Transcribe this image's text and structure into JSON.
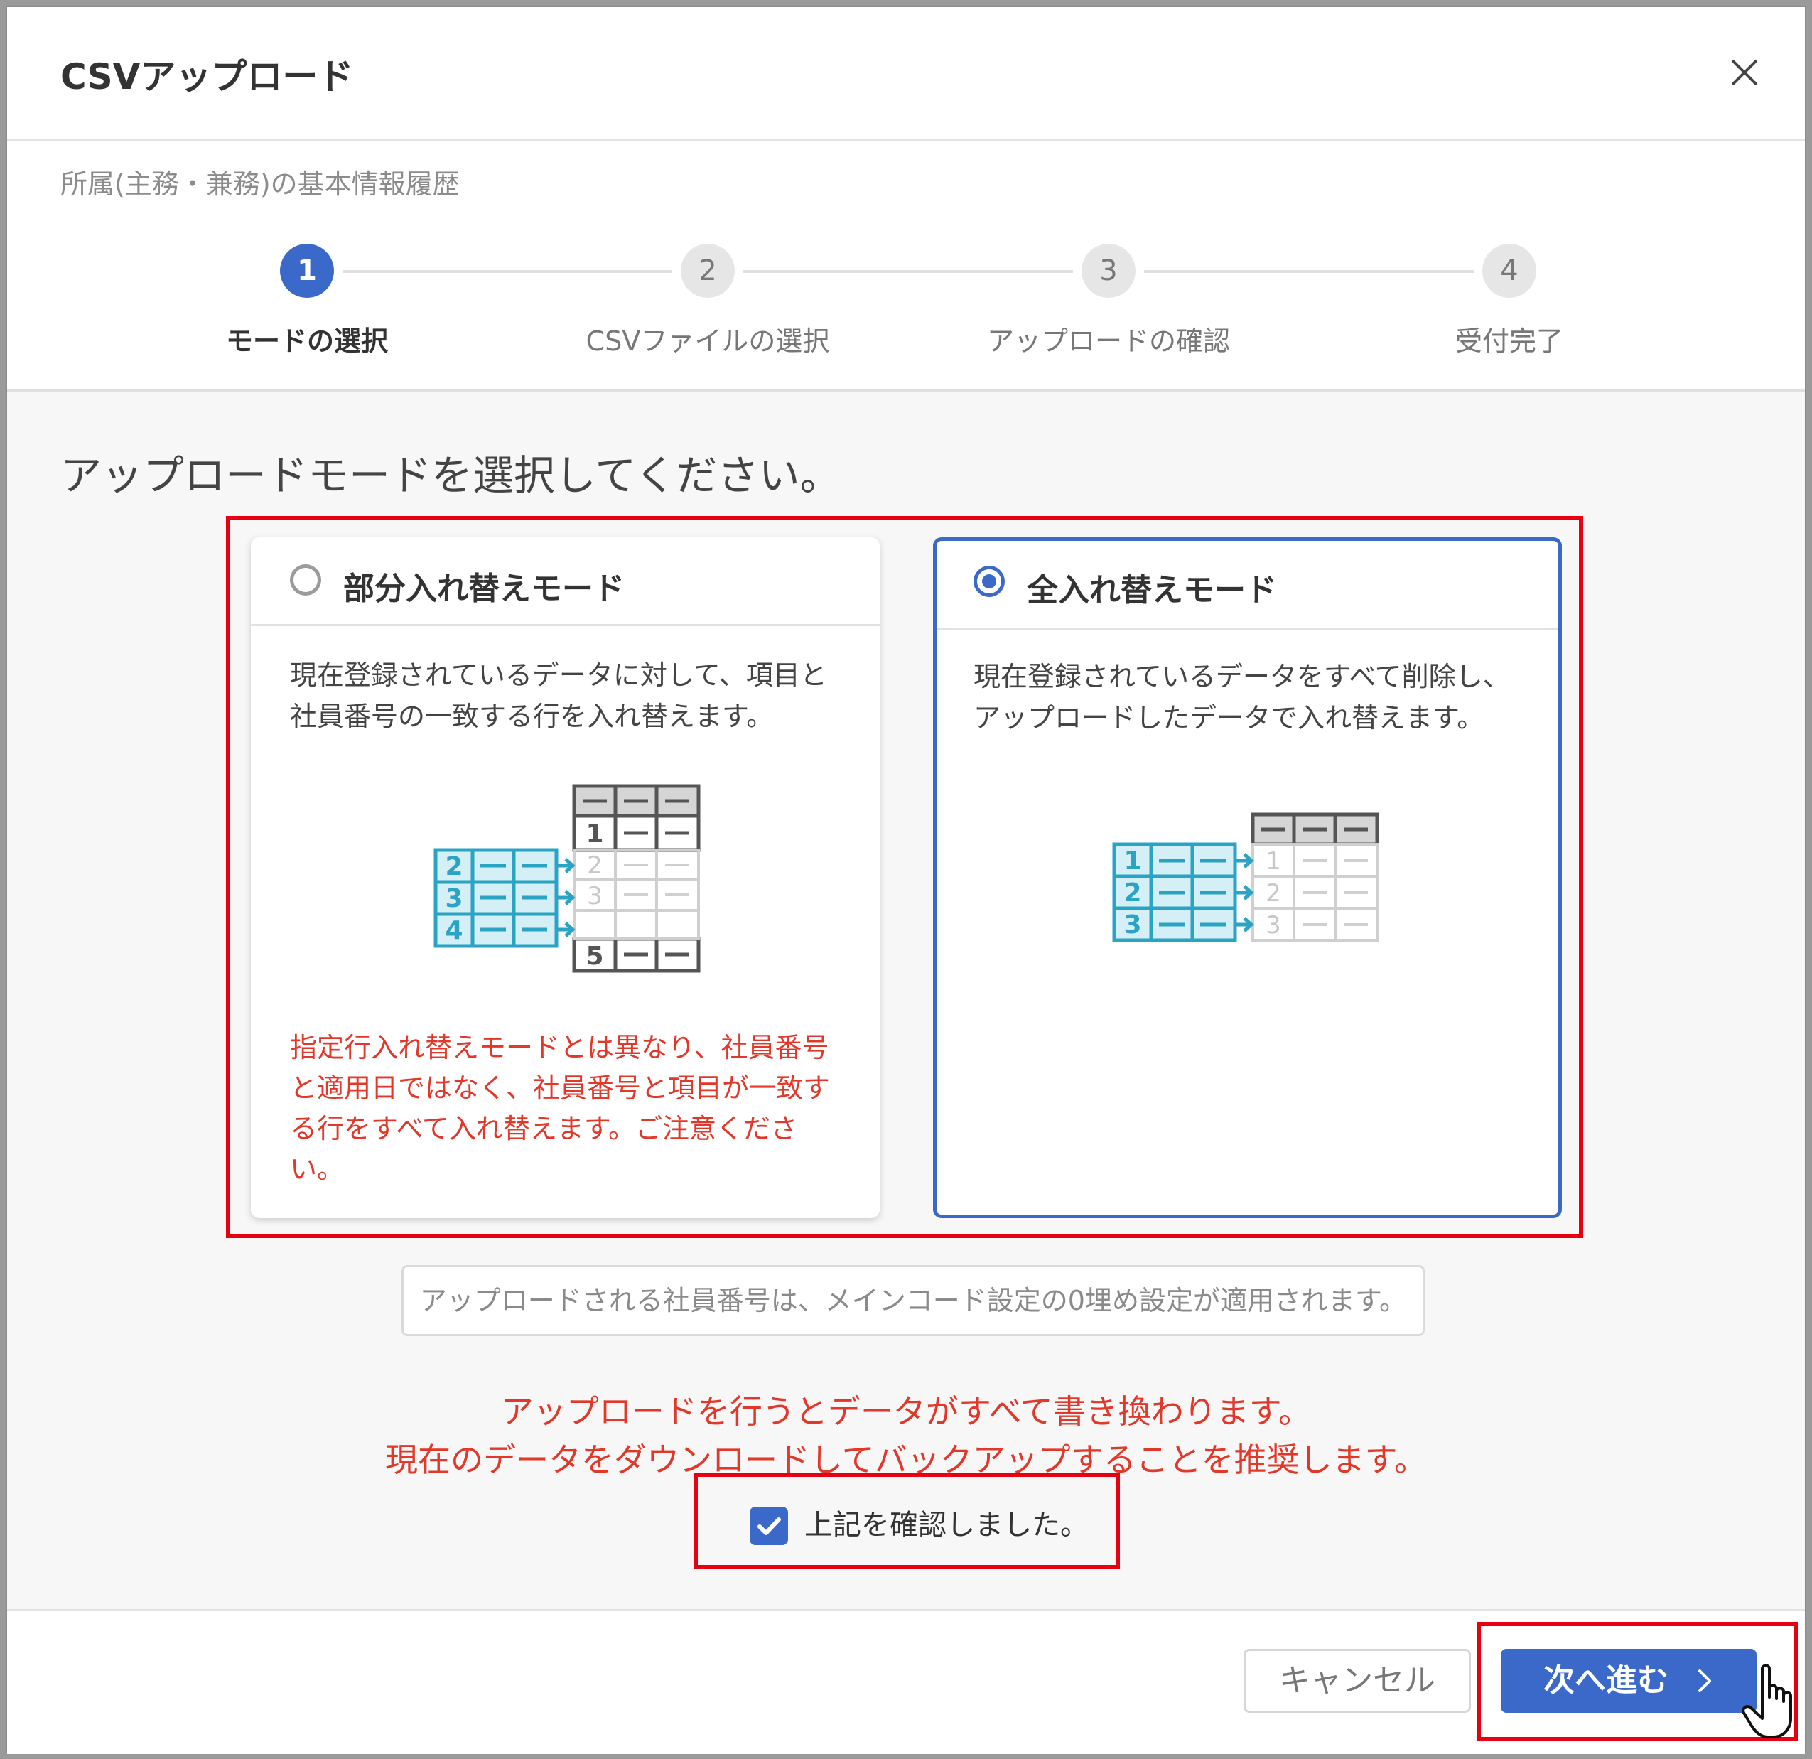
{
  "dialog": {
    "title": "CSVアップロード",
    "subtitle": "所属(主務・兼務)の基本情報履歴"
  },
  "steps": [
    {
      "number": "1",
      "label": "モードの選択",
      "active": true
    },
    {
      "number": "2",
      "label": "CSVファイルの選択",
      "active": false
    },
    {
      "number": "3",
      "label": "アップロードの確認",
      "active": false
    },
    {
      "number": "4",
      "label": "受付完了",
      "active": false
    }
  ],
  "prompt": "アップロードモードを選択してください。",
  "modes": {
    "partial": {
      "title": "部分入れ替えモード",
      "selected": false,
      "description": [
        "現在登録されているデータに対して、項目と",
        "社員番号の一致する行を入れ替えます。"
      ],
      "warning": [
        "指定行入れ替えモードとは異なり、社員番号",
        "と適用日ではなく、社員番号と項目が一致す",
        "る行をすべて入れ替えます。ご注意くださ",
        "い。"
      ],
      "new_rows": [
        "2",
        "3",
        "4"
      ],
      "existing_rows": [
        "1",
        "2",
        "3",
        "5"
      ]
    },
    "full": {
      "title": "全入れ替えモード",
      "selected": true,
      "description": [
        "現在登録されているデータをすべて削除し、",
        "アップロードしたデータで入れ替えます。"
      ],
      "new_rows": [
        "1",
        "2",
        "3"
      ],
      "existing_rows": [
        "1",
        "2",
        "3"
      ]
    }
  },
  "info": "アップロードされる社員番号は、メインコード設定の0埋め設定が適用されます。",
  "warnings": [
    "アップロードを行うとデータがすべて書き換わります。",
    "現在のデータをダウンロードしてバックアップすることを推奨します。"
  ],
  "confirm": {
    "label": "上記を確認しました。",
    "checked": true
  },
  "footer": {
    "cancel": "キャンセル",
    "next": "次へ進む"
  },
  "colors": {
    "primary": "#3a69c9",
    "warning": "#e2382a",
    "highlight": "#e60012",
    "teal": "#2aa3c4"
  }
}
